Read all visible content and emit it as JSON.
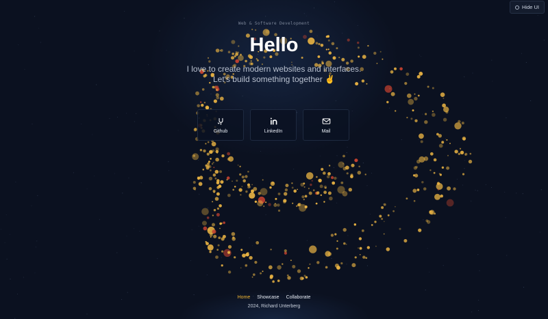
{
  "header": {
    "hide_ui_label": "Hide UI",
    "hide_ui_icon": "eye-icon"
  },
  "hero": {
    "eyebrow": "Web & Software Development",
    "title": "Hello",
    "subtitle": "I love to create modern websites and interfaces. Let's build something together ✌️"
  },
  "links": [
    {
      "label": "Github",
      "icon": "github-icon"
    },
    {
      "label": "LinkedIn",
      "icon": "linkedin-icon"
    },
    {
      "label": "Mail",
      "icon": "mail-icon"
    }
  ],
  "footer": {
    "nav": [
      {
        "label": "Home",
        "active": true
      },
      {
        "label": "Showcase",
        "active": false
      },
      {
        "label": "Collaborate",
        "active": false
      }
    ],
    "copyright": "2024, Richard Unterberg"
  },
  "colors": {
    "background": "#0b1120",
    "accent": "#f2b632",
    "emoji_gold": "#e9b343",
    "emoji_red": "#c2412f"
  }
}
